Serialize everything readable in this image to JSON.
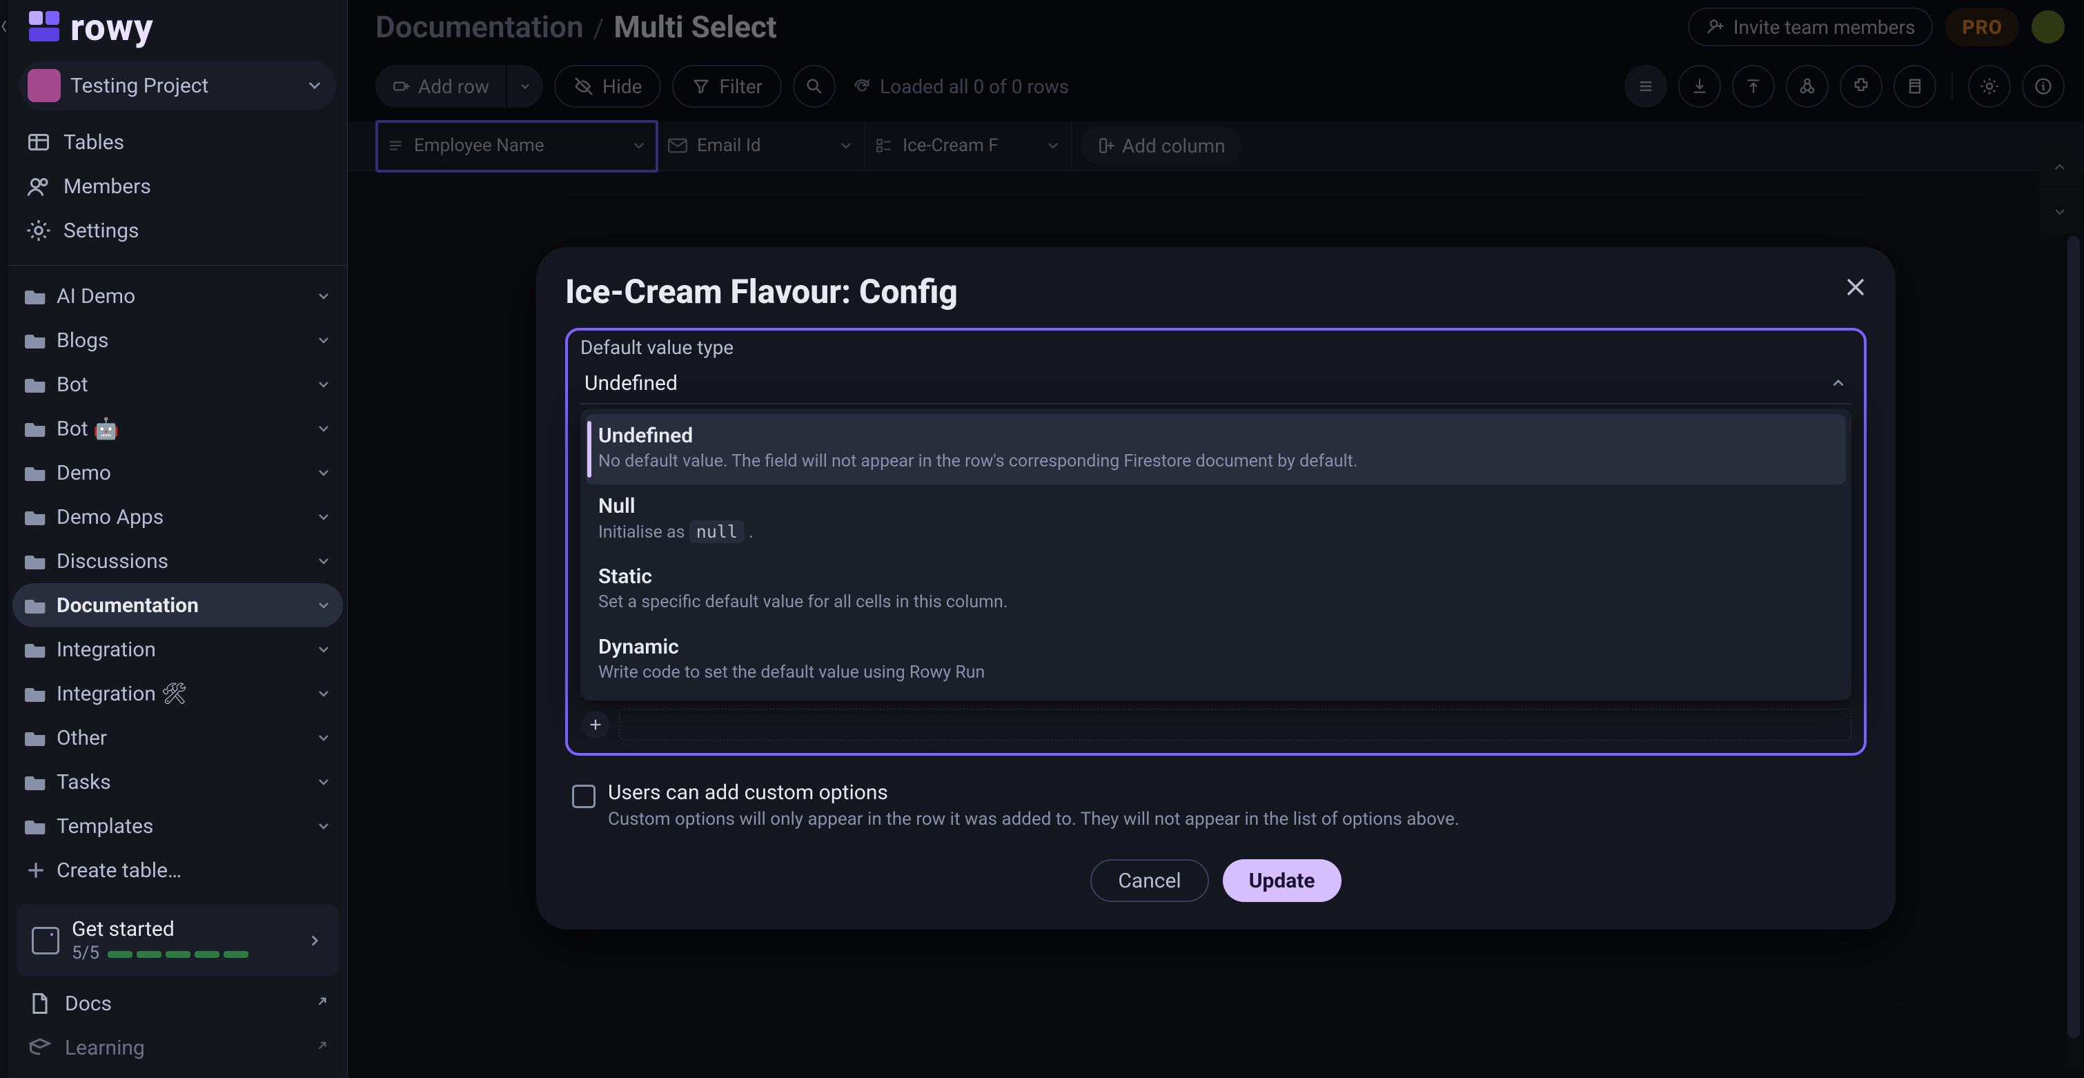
{
  "brand": {
    "name": "rowy"
  },
  "project": {
    "name": "Testing Project"
  },
  "sidebar": {
    "groups": [
      "Tables",
      "Members",
      "Settings"
    ],
    "tree": [
      {
        "label": "AI Demo",
        "active": false
      },
      {
        "label": "Blogs",
        "active": false
      },
      {
        "label": "Bot",
        "active": false
      },
      {
        "label": "Bot 🤖",
        "active": false
      },
      {
        "label": "Demo",
        "active": false
      },
      {
        "label": "Demo Apps",
        "active": false
      },
      {
        "label": "Discussions",
        "active": false
      },
      {
        "label": "Documentation",
        "active": true
      },
      {
        "label": "Integration",
        "active": false
      },
      {
        "label": "Integration 🛠",
        "active": false
      },
      {
        "label": "Other",
        "active": false
      },
      {
        "label": "Tasks",
        "active": false
      },
      {
        "label": "Templates",
        "active": false
      }
    ],
    "create_table": "Create table…",
    "footer": {
      "get_started": "Get started",
      "progress_text": "5/5",
      "docs": "Docs",
      "learning": "Learning"
    }
  },
  "header": {
    "breadcrumb": {
      "root": "Documentation",
      "sep": "/",
      "leaf": "Multi Select"
    },
    "invite": "Invite team members",
    "pro": "PRO"
  },
  "toolbar": {
    "add_row": "Add row",
    "hide": "Hide",
    "filter": "Filter",
    "loaded": "Loaded all 0 of 0 rows"
  },
  "columns": [
    {
      "name": "Employee Name",
      "type": "text",
      "selected": true
    },
    {
      "name": "Email Id",
      "type": "email",
      "selected": false
    },
    {
      "name": "Ice-Cream Flavour",
      "type": "multiselect",
      "selected": false,
      "truncated": "Ice-Cream F"
    }
  ],
  "add_column": "Add column",
  "dialog": {
    "title": "Ice-Cream Flavour: Config",
    "default_value_type_label": "Default value type",
    "selected_type": "Undefined",
    "options": [
      {
        "title": "Undefined",
        "sub_prefix": "No default value. The field will not appear in the row's corresponding Firestore document by default.",
        "active": true
      },
      {
        "title": "Null",
        "sub_prefix": "Initialise as ",
        "code": "null",
        "sub_suffix": " ."
      },
      {
        "title": "Static",
        "sub_prefix": "Set a specific default value for all cells in this column."
      },
      {
        "title": "Dynamic",
        "sub_prefix": "Write code to set the default value using Rowy Run"
      }
    ],
    "custom_options": {
      "title": "Users can add custom options",
      "sub": "Custom options will only appear in the row it was added to. They will not appear in the list of options above."
    },
    "cancel": "Cancel",
    "update": "Update"
  }
}
